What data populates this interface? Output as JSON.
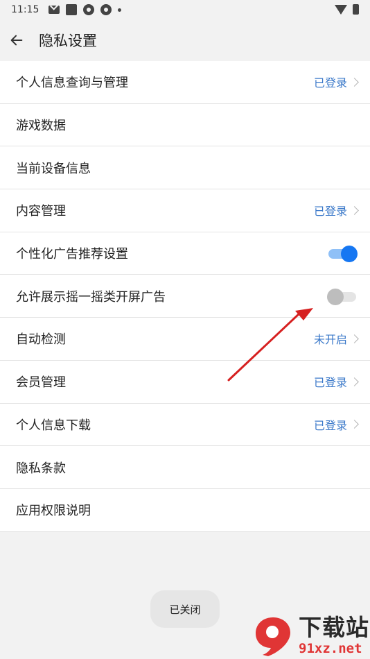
{
  "status_bar": {
    "time": "11:15",
    "icons": [
      "mail-icon",
      "square-app-icon",
      "aperture-icon",
      "aperture-icon",
      "dot-icon",
      "wifi-icon",
      "battery-icon"
    ]
  },
  "app_bar": {
    "back_icon": "arrow-left-icon",
    "title": "隐私设置"
  },
  "settings": [
    {
      "label": "个人信息查询与管理",
      "value": "已登录",
      "type": "link"
    },
    {
      "label": "游戏数据",
      "type": "plain"
    },
    {
      "label": "当前设备信息",
      "type": "plain"
    },
    {
      "label": "内容管理",
      "value": "已登录",
      "type": "link"
    },
    {
      "label": "个性化广告推荐设置",
      "type": "toggle",
      "on": true
    },
    {
      "label": "允许展示摇一摇类开屏广告",
      "type": "toggle",
      "on": false
    },
    {
      "label": "自动检测",
      "value": "未开启",
      "type": "link"
    },
    {
      "label": "会员管理",
      "value": "已登录",
      "type": "link"
    },
    {
      "label": "个人信息下载",
      "value": "已登录",
      "type": "link"
    },
    {
      "label": "隐私条款",
      "type": "plain"
    },
    {
      "label": "应用权限说明",
      "type": "plain"
    }
  ],
  "toast": "已关闭",
  "colors": {
    "accent": "#1677f2",
    "value_text": "#3a78c9",
    "annotation_arrow": "#d62020",
    "background": "#f2f2f2"
  },
  "watermark": {
    "title": "下载站",
    "url": "91xz.net",
    "logo_text": "9"
  }
}
